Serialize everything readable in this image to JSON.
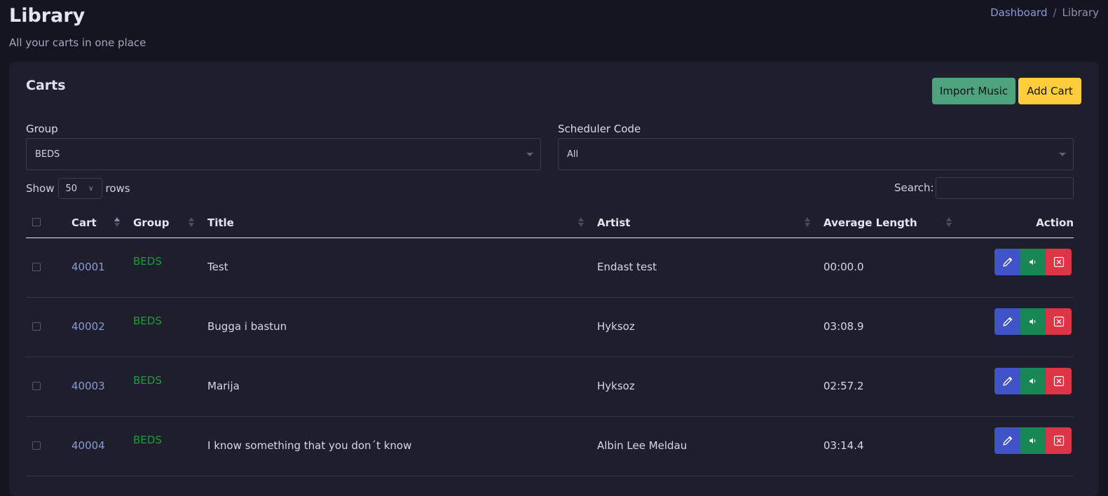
{
  "header": {
    "title": "Library",
    "subtitle": "All your carts in one place",
    "breadcrumb": {
      "home": "Dashboard",
      "current": "Library",
      "separator": "/"
    }
  },
  "card": {
    "title": "Carts",
    "import_label": "Import Music",
    "add_label": "Add Cart"
  },
  "filters": {
    "group_label": "Group",
    "group_value": "BEDS",
    "scheduler_label": "Scheduler Code",
    "scheduler_value": "All"
  },
  "table_controls": {
    "show_label": "Show",
    "rows_value": "50",
    "rows_label": "rows",
    "search_label": "Search:",
    "search_value": ""
  },
  "table": {
    "columns": {
      "cart": "Cart",
      "group": "Group",
      "title": "Title",
      "artist": "Artist",
      "length": "Average Length",
      "action": "Action"
    },
    "rows": [
      {
        "cart": "40001",
        "group": "BEDS",
        "title": "Test",
        "artist": "Endast test",
        "length": "00:00.0"
      },
      {
        "cart": "40002",
        "group": "BEDS",
        "title": "Bugga i bastun",
        "artist": "Hyksoz",
        "length": "03:08.9"
      },
      {
        "cart": "40003",
        "group": "BEDS",
        "title": "Marija",
        "artist": "Hyksoz",
        "length": "02:57.2"
      },
      {
        "cart": "40004",
        "group": "BEDS",
        "title": "I know something that you don´t know",
        "artist": "Albin Lee Meldau",
        "length": "03:14.4"
      }
    ]
  },
  "icons": {
    "edit": "pencil-icon",
    "play": "speaker-icon",
    "delete": "close-box-icon",
    "sort": "sort-icon"
  },
  "colors": {
    "background": "#151521",
    "card": "#1e1e2d",
    "import_button": "#4ea27d",
    "add_button": "#ffcd39",
    "edit_button": "#4054c8",
    "play_button": "#198754",
    "delete_button": "#dc3545",
    "link": "#8a9ad6",
    "group_tag": "#1f9d35"
  }
}
